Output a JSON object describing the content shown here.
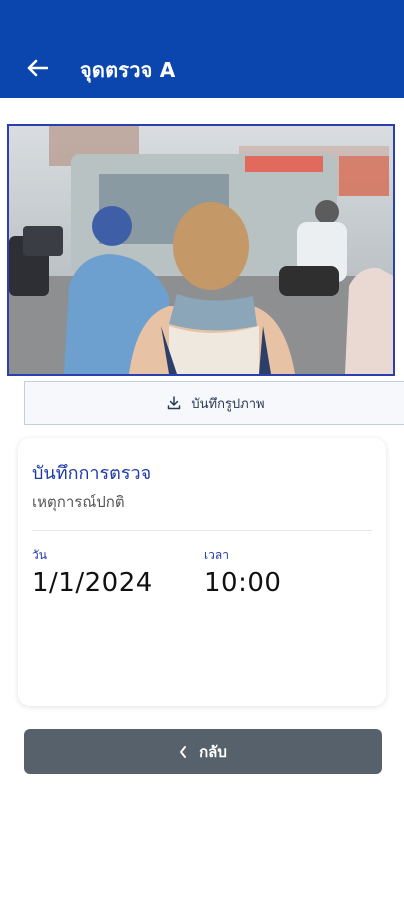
{
  "header": {
    "title": "จุดตรวจ A",
    "back_icon": "arrow-left-icon",
    "background": "#0a46ae"
  },
  "photo": {
    "alt": "street scene photo",
    "border_color": "#2a3fb0"
  },
  "save_photo": {
    "label": "บันทึกรูปภาพ",
    "icon": "download-icon"
  },
  "record": {
    "title": "บันทึกการตรวจ",
    "status": "เหตุการณ์ปกติ",
    "date_label": "วัน",
    "date_value": "1/1/2024",
    "time_label": "เวลา",
    "time_value": "10:00"
  },
  "footer": {
    "back_label": "กลับ",
    "back_icon": "chevron-left-icon",
    "button_color": "#56616c"
  }
}
